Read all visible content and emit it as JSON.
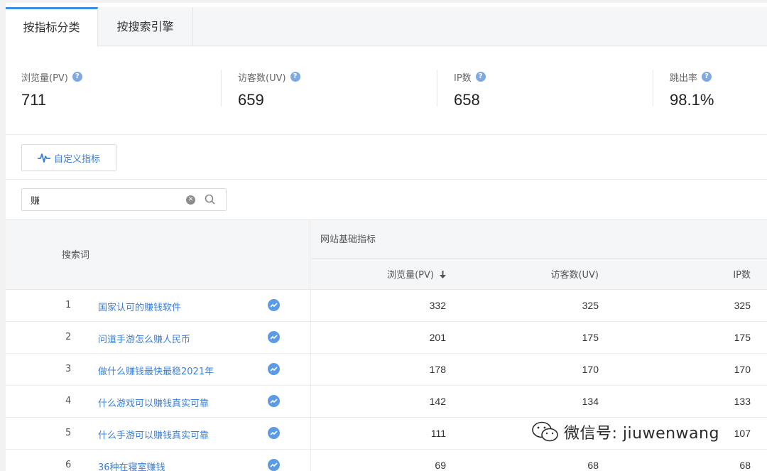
{
  "tabs": [
    {
      "label": "按指标分类",
      "active": true
    },
    {
      "label": "按搜索引擎",
      "active": false
    }
  ],
  "metrics": [
    {
      "label": "浏览量(PV)",
      "value": "711"
    },
    {
      "label": "访客数(UV)",
      "value": "659"
    },
    {
      "label": "IP数",
      "value": "658"
    },
    {
      "label": "跳出率",
      "value": "98.1%"
    }
  ],
  "custom_button": {
    "label": "自定义指标",
    "icon": "pulse-icon"
  },
  "search": {
    "value": "赚"
  },
  "table": {
    "keyword_header": "搜索词",
    "group_header": "网站基础指标",
    "columns": [
      "浏览量(PV)",
      "访客数(UV)",
      "IP数"
    ],
    "rows": [
      {
        "idx": "1",
        "keyword": "国家认可的赚钱软件",
        "pv": "332",
        "uv": "325",
        "ip": "325"
      },
      {
        "idx": "2",
        "keyword": "问道手游怎么赚人民币",
        "pv": "201",
        "uv": "175",
        "ip": "175"
      },
      {
        "idx": "3",
        "keyword": "做什么赚钱最快最稳2021年",
        "pv": "178",
        "uv": "170",
        "ip": "170"
      },
      {
        "idx": "4",
        "keyword": "什么游戏可以赚钱真实可靠",
        "pv": "142",
        "uv": "134",
        "ip": "133"
      },
      {
        "idx": "5",
        "keyword": "什么手游可以赚钱真实可靠",
        "pv": "111",
        "uv": "",
        "ip": "107"
      },
      {
        "idx": "6",
        "keyword": "36种在寝室赚钱",
        "pv": "69",
        "uv": "68",
        "ip": "68"
      }
    ]
  },
  "watermark": {
    "text": "微信号: jiuwenwang"
  },
  "colors": {
    "accent": "#3a8ee6",
    "link": "#3a7fd5",
    "icon": "#5b9be6"
  }
}
